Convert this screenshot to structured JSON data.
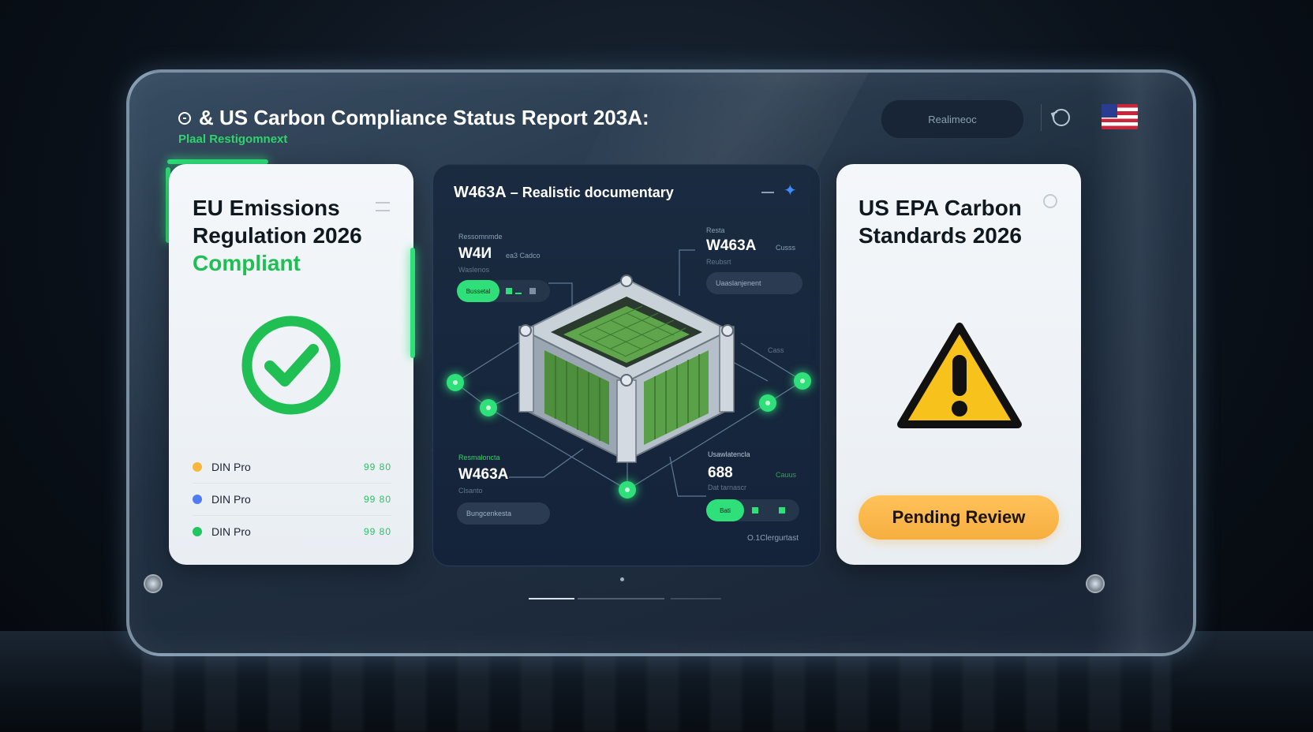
{
  "header": {
    "title": "& US Carbon Compliance Status Report 203A:",
    "subtitle": "Plaal Restigomnext",
    "search_placeholder": "Realimeoc"
  },
  "eu_card": {
    "title": "EU Emissions Regulation 2026",
    "status": "Compliant",
    "legend": [
      {
        "label": "DIN Pro",
        "value": "99 80",
        "color": "#f6b73c"
      },
      {
        "label": "DIN Pro",
        "value": "99 80",
        "color": "#4f7cf0"
      },
      {
        "label": "DIN Pro",
        "value": "99 80",
        "color": "#22c55e"
      }
    ]
  },
  "center_card": {
    "title_id": "W463A",
    "title_text": "– Realistic documentary",
    "tl": {
      "label": "Ressomnmde",
      "id": "W4И",
      "tag": "ea3 Cadco",
      "sub": "Waslenos",
      "pill": "Bussetal"
    },
    "tr": {
      "label": "Resta",
      "id": "W463A",
      "tag": "Cusss",
      "sub": "Reubsrt",
      "pill": "Uaaslanjenent"
    },
    "bl": {
      "label": "Resmaloncta",
      "id": "W463A",
      "sub": "Clsanto",
      "pill": "Bungcenkesta"
    },
    "br": {
      "label": "Usawlatencla",
      "id": "688",
      "tag": "Cauus",
      "sub": "Dat tarnascr",
      "pill": "Bati"
    },
    "side_label": "Cass",
    "footer": "O.1Clergurtast"
  },
  "us_card": {
    "title": "US EPA Carbon Standards 2026",
    "button": "Pending Review"
  },
  "colors": {
    "accent_green": "#2fe07a",
    "compliant_green": "#1fbf54",
    "warning_yellow": "#f6c21b",
    "pending_orange": "#f6ae3f",
    "star_blue": "#3d8cff"
  }
}
